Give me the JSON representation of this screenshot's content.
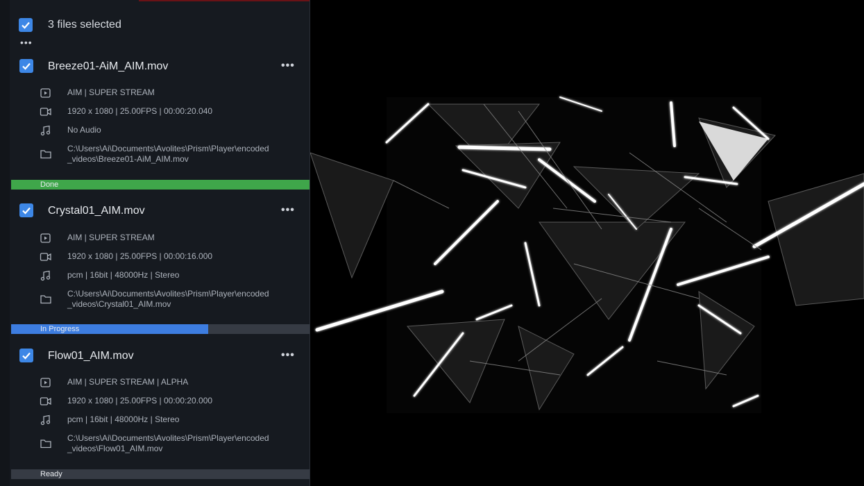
{
  "header": {
    "selection_label": "3 files selected",
    "more_glyph": "•••"
  },
  "files": [
    {
      "name": "Breeze01-AiM_AIM.mov",
      "more_glyph": "•••",
      "format": "AIM | SUPER STREAM",
      "video": "1920 x 1080 | 25.00FPS | 00:00:20.040",
      "audio": "No Audio",
      "path": "C:\\Users\\Ai\\Documents\\Avolites\\Prism\\Player\\encoded _videos\\Breeze01-AiM_AIM.mov",
      "status": {
        "label": "Done",
        "progress": 1.0,
        "color": "#3fa64a"
      }
    },
    {
      "name": "Crystal01_AIM.mov",
      "more_glyph": "•••",
      "format": "AIM | SUPER STREAM",
      "video": "1920 x 1080 | 25.00FPS | 00:00:16.000",
      "audio": "pcm | 16bit | 48000Hz | Stereo",
      "path": "C:\\Users\\Ai\\Documents\\Avolites\\Prism\\Player\\encoded _videos\\Crystal01_AIM.mov",
      "status": {
        "label": "In Progress",
        "progress": 0.66,
        "color": "#3d7de0"
      }
    },
    {
      "name": "Flow01_AIM.mov",
      "more_glyph": "•••",
      "format": "AIM | SUPER STREAM | ALPHA",
      "video": "1920 x 1080 | 25.00FPS | 00:00:20.000",
      "audio": "pcm | 16bit | 48000Hz | Stereo",
      "path": "C:\\Users\\Ai\\Documents\\Avolites\\Prism\\Player\\encoded _videos\\Flow01_AIM.mov",
      "status": {
        "label": "Ready",
        "progress": 0.0,
        "color": "#3d7de0"
      }
    }
  ],
  "icons": [
    "check-icon",
    "format-icon",
    "video-icon",
    "audio-icon",
    "folder-icon"
  ],
  "colors": {
    "panel_bg": "#161a20",
    "checkbox": "#3d87e6",
    "done": "#3fa64a",
    "in_progress": "#3d7de0",
    "track": "#363b44"
  }
}
